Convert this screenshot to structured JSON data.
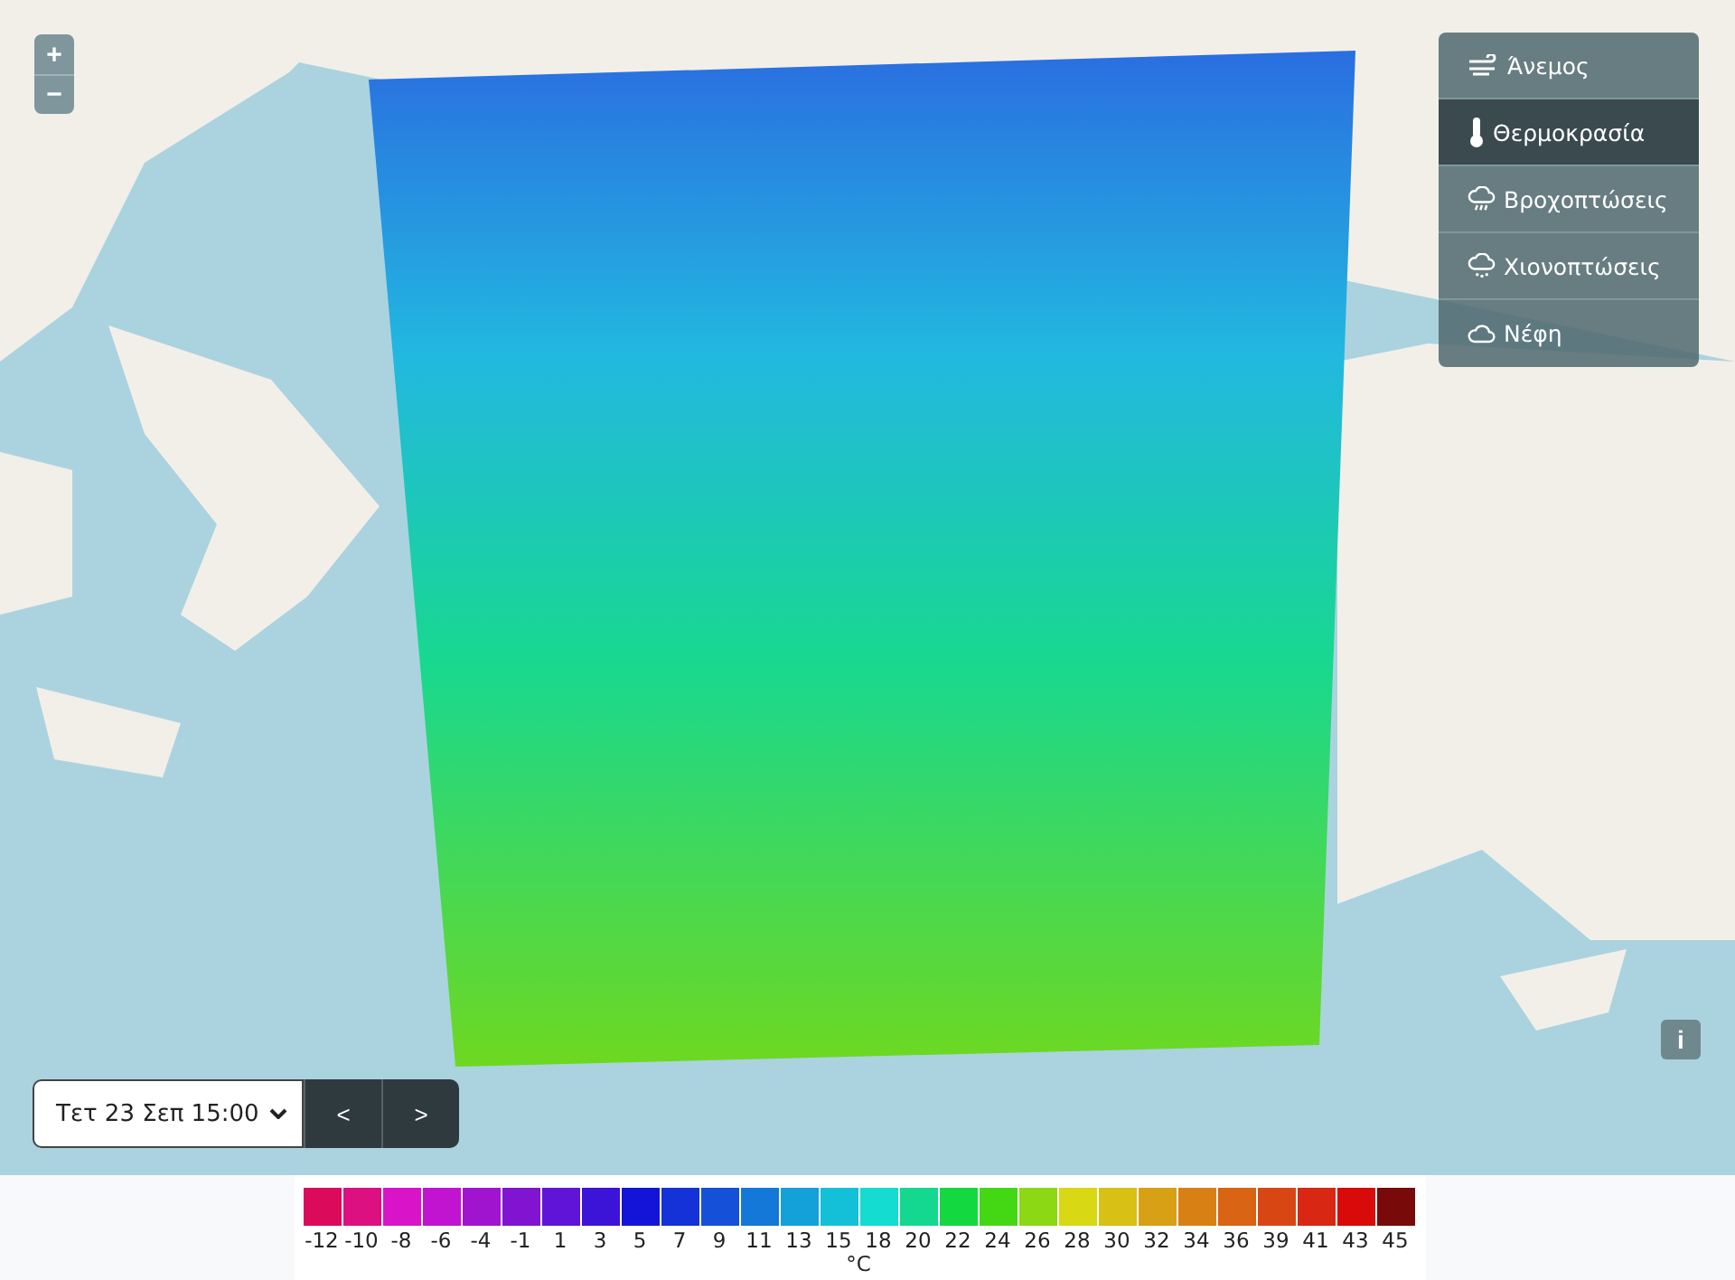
{
  "zoom": {
    "plus": "+",
    "minus": "−"
  },
  "layers": [
    {
      "kind": "wind",
      "label": "Άνεμος",
      "selected": false
    },
    {
      "kind": "temperature",
      "label": "Θερμοκρασία",
      "selected": true
    },
    {
      "kind": "rain",
      "label": "Βροχοπτώσεις",
      "selected": false
    },
    {
      "kind": "snow",
      "label": "Χιονοπτώσεις",
      "selected": false
    },
    {
      "kind": "clouds",
      "label": "Νέφη",
      "selected": false
    }
  ],
  "info_button": "i",
  "time_selector": {
    "value": "Τετ 23 Σεπ 15:00",
    "prev": "<",
    "next": ">"
  },
  "legend": {
    "unit": "°C",
    "items": [
      {
        "label": "-12",
        "color": "#dc0a5a"
      },
      {
        "label": "-10",
        "color": "#dc1080"
      },
      {
        "label": "-8",
        "color": "#d914c8"
      },
      {
        "label": "-6",
        "color": "#c014d0"
      },
      {
        "label": "-4",
        "color": "#a014d0"
      },
      {
        "label": "-1",
        "color": "#8014d0"
      },
      {
        "label": "1",
        "color": "#6014d8"
      },
      {
        "label": "3",
        "color": "#3c14d8"
      },
      {
        "label": "5",
        "color": "#1414d8"
      },
      {
        "label": "7",
        "color": "#1432d8"
      },
      {
        "label": "9",
        "color": "#1450d8"
      },
      {
        "label": "11",
        "color": "#1478d8"
      },
      {
        "label": "13",
        "color": "#14a0d8"
      },
      {
        "label": "15",
        "color": "#14c0d8"
      },
      {
        "label": "18",
        "color": "#14dcd0"
      },
      {
        "label": "20",
        "color": "#14d890"
      },
      {
        "label": "22",
        "color": "#14d840"
      },
      {
        "label": "24",
        "color": "#44d814"
      },
      {
        "label": "26",
        "color": "#8cd814"
      },
      {
        "label": "28",
        "color": "#d8d814"
      },
      {
        "label": "30",
        "color": "#d8c014"
      },
      {
        "label": "32",
        "color": "#d8a014"
      },
      {
        "label": "34",
        "color": "#d88014"
      },
      {
        "label": "36",
        "color": "#d86414"
      },
      {
        "label": "39",
        "color": "#d84614"
      },
      {
        "label": "41",
        "color": "#d82814"
      },
      {
        "label": "43",
        "color": "#d80a0a"
      },
      {
        "label": "45",
        "color": "#780a0a"
      }
    ]
  }
}
